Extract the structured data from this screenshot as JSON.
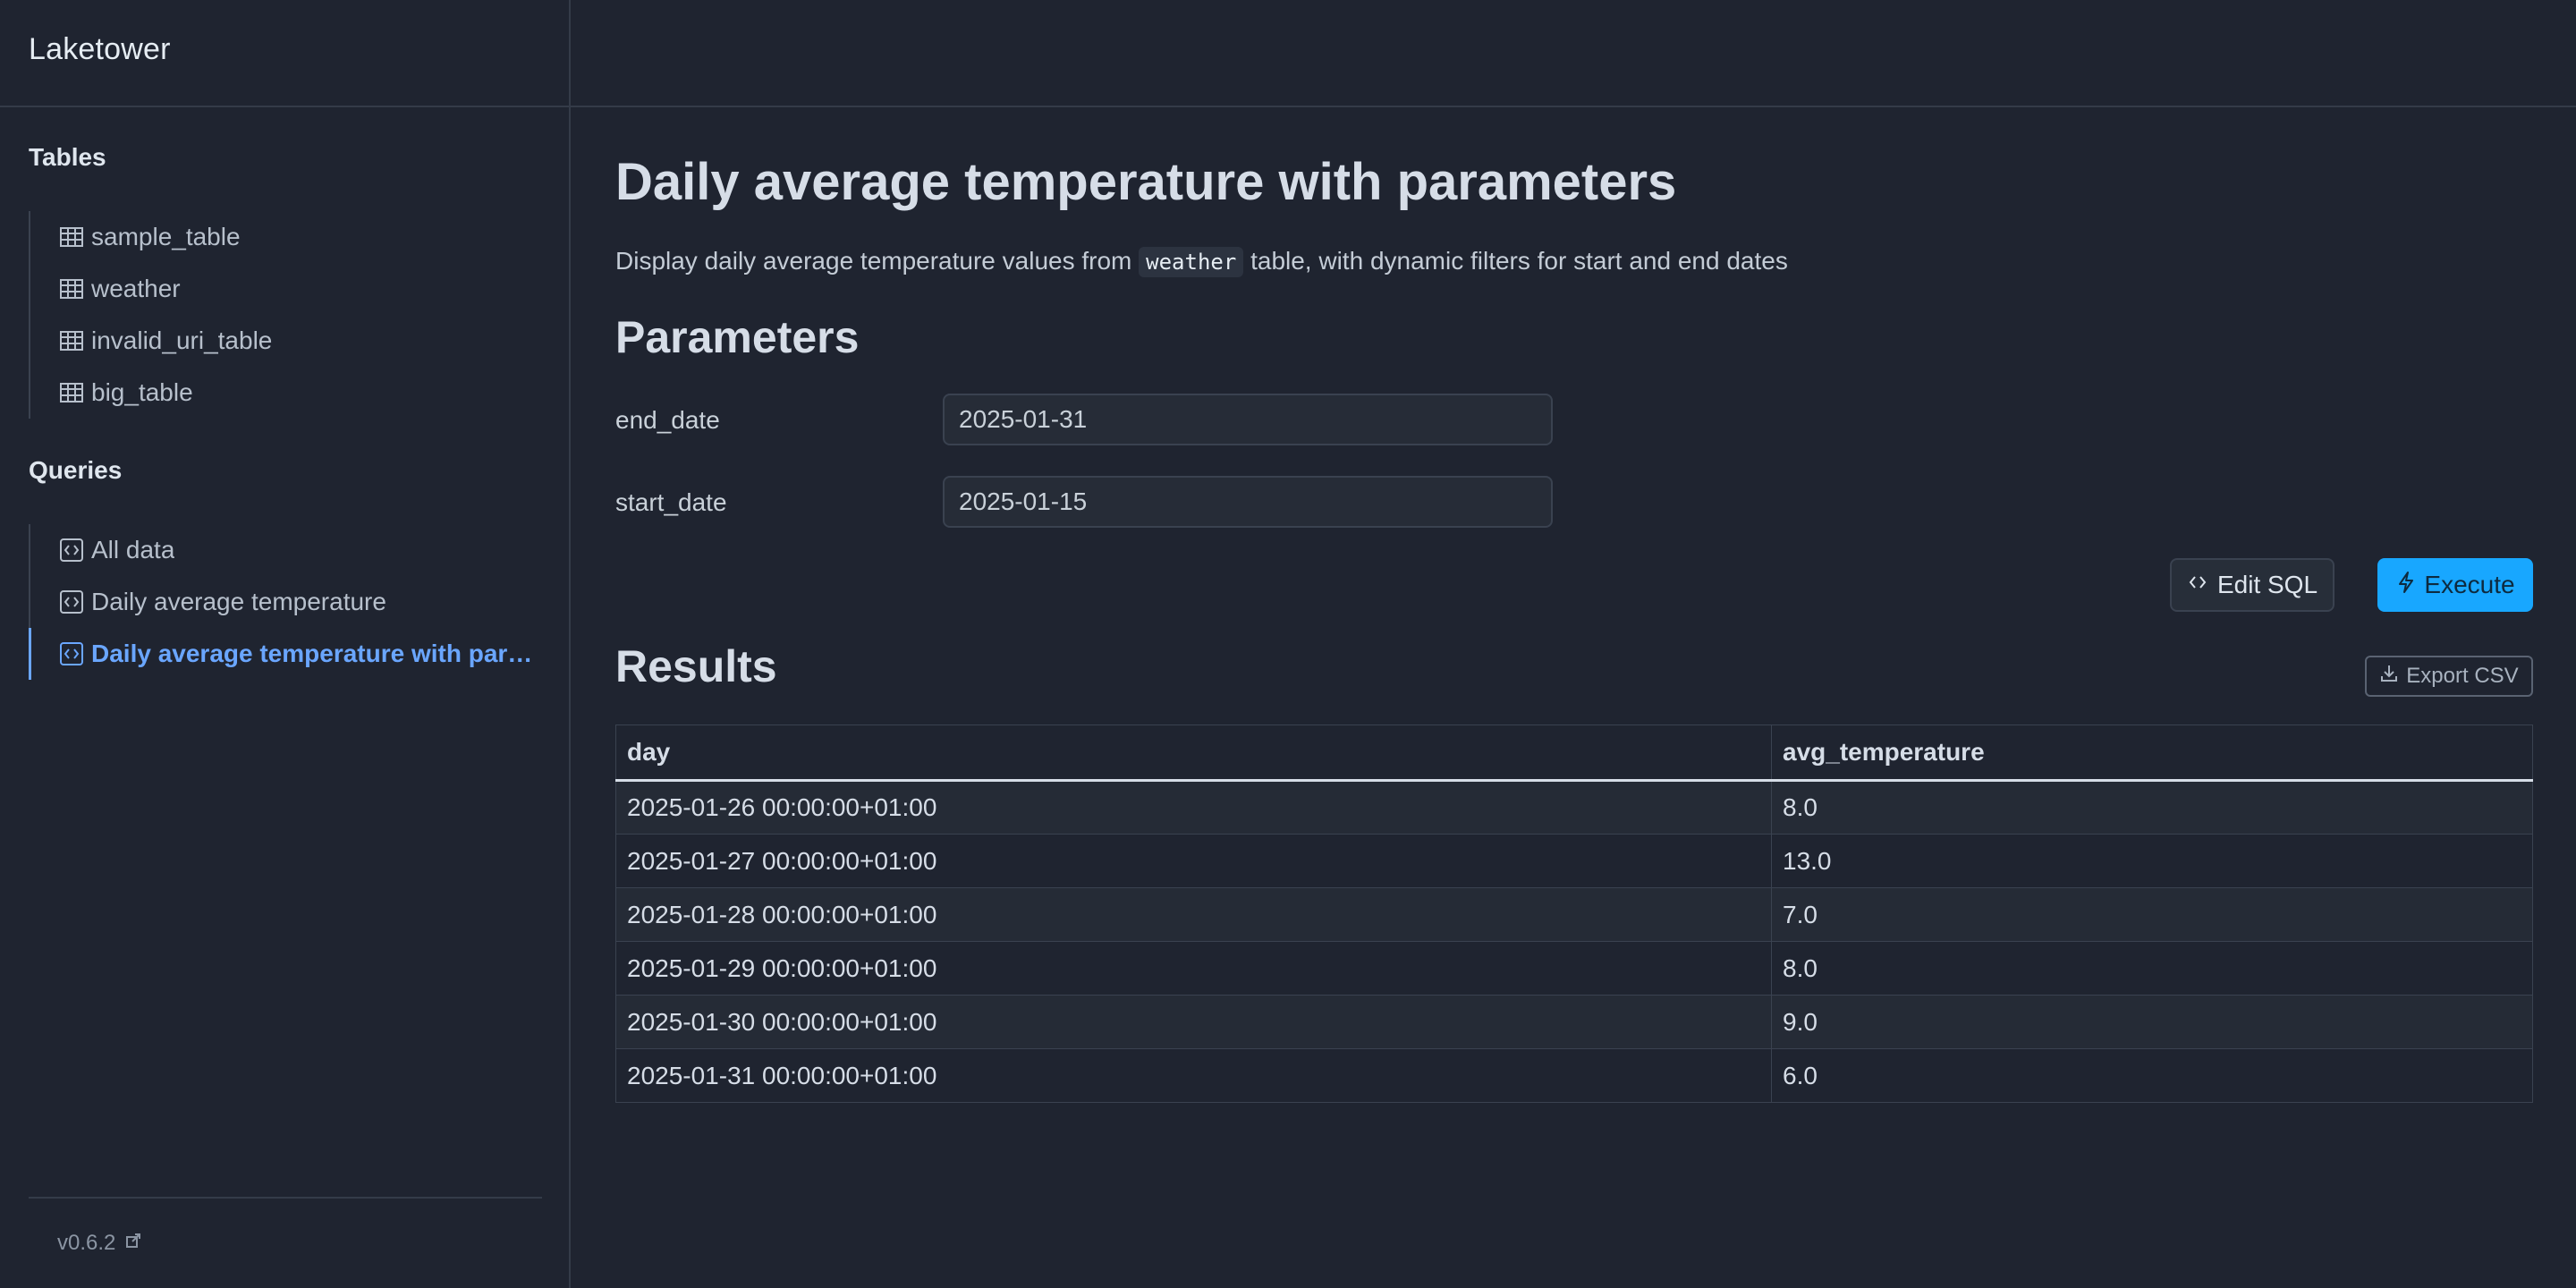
{
  "app": {
    "title": "Laketower"
  },
  "sidebar": {
    "tables_title": "Tables",
    "tables": [
      {
        "label": "sample_table",
        "icon": "table-icon"
      },
      {
        "label": "weather",
        "icon": "table-icon"
      },
      {
        "label": "invalid_uri_table",
        "icon": "table-icon"
      },
      {
        "label": "big_table",
        "icon": "table-icon"
      }
    ],
    "queries_title": "Queries",
    "queries": [
      {
        "label": "All data",
        "icon": "code-icon"
      },
      {
        "label": "Daily average temperature",
        "icon": "code-icon"
      },
      {
        "label": "Daily average temperature with parameters",
        "icon": "code-icon",
        "active": true
      }
    ],
    "version": "v0.6.2"
  },
  "main": {
    "title": "Daily average temperature with parameters",
    "description_before": "Display daily average temperature values from ",
    "description_code": "weather",
    "description_after": " table, with dynamic filters for start and end dates",
    "parameters_title": "Parameters",
    "parameters": [
      {
        "label": "end_date",
        "value": "2025-01-31"
      },
      {
        "label": "start_date",
        "value": "2025-01-15"
      }
    ],
    "edit_sql_label": "Edit SQL",
    "execute_label": "Execute",
    "results_title": "Results",
    "export_label": "Export CSV"
  },
  "results": {
    "columns": [
      "day",
      "avg_temperature"
    ],
    "rows": [
      [
        "2025-01-26 00:00:00+01:00",
        "8.0"
      ],
      [
        "2025-01-27 00:00:00+01:00",
        "13.0"
      ],
      [
        "2025-01-28 00:00:00+01:00",
        "7.0"
      ],
      [
        "2025-01-29 00:00:00+01:00",
        "8.0"
      ],
      [
        "2025-01-30 00:00:00+01:00",
        "9.0"
      ],
      [
        "2025-01-31 00:00:00+01:00",
        "6.0"
      ]
    ]
  },
  "colors": {
    "accent": "#18a7ff",
    "active_link": "#6aa6ff",
    "background": "#1f2430"
  }
}
